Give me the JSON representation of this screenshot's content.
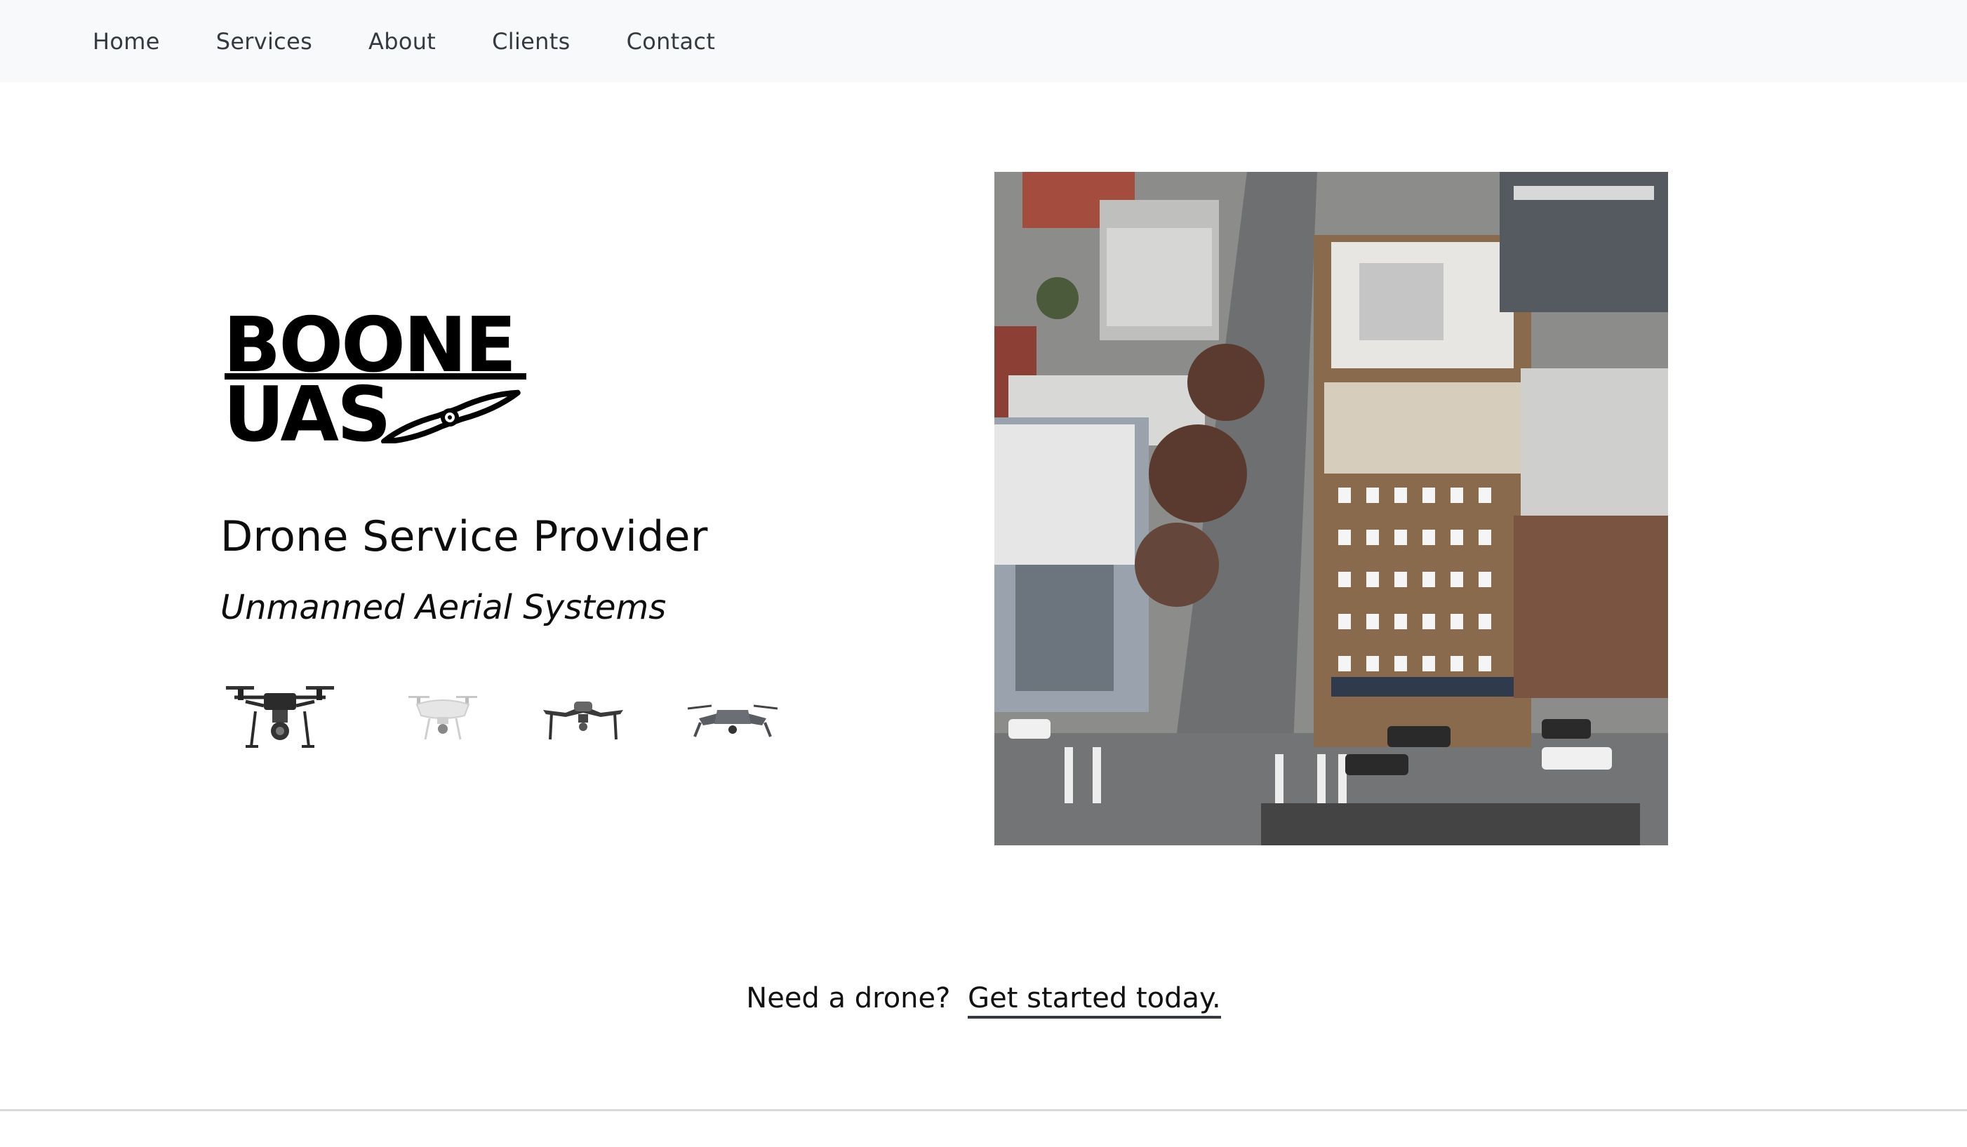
{
  "nav": {
    "items": [
      {
        "label": "Home"
      },
      {
        "label": "Services"
      },
      {
        "label": "About"
      },
      {
        "label": "Clients"
      },
      {
        "label": "Contact"
      }
    ]
  },
  "hero": {
    "logo_line1": "BOONE",
    "logo_line2": "UAS",
    "tagline": "Drone Service Provider",
    "subtitle": "Unmanned Aerial Systems",
    "drone_icons": [
      "matrice-drone-icon",
      "phantom-drone-icon",
      "inspire-drone-icon",
      "mavic-drone-icon"
    ],
    "photo_icon": "aerial-city-photo"
  },
  "cta": {
    "prompt": "Need a drone?",
    "link_label": "Get started today."
  },
  "colors": {
    "nav_bg": "#f8f9fa",
    "nav_text": "#343a40",
    "text": "#111111",
    "divider": "#d9d9d9"
  }
}
